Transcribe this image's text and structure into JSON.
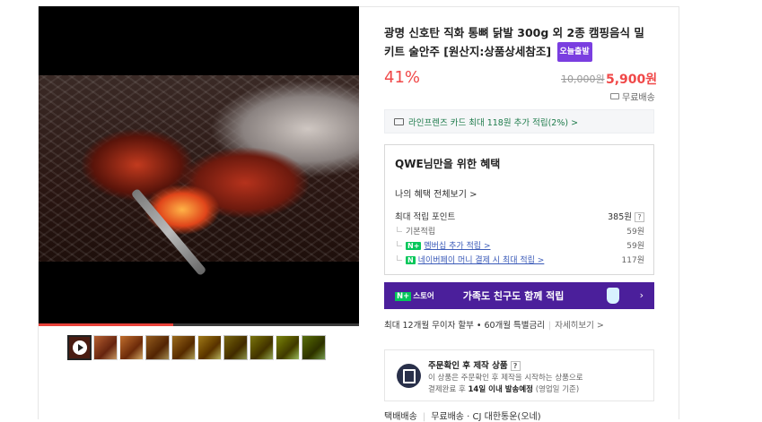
{
  "product": {
    "title": "광명 신호탄 직화 통뼈 닭발 300g 외 2종 캠핑음식 밀키트 술안주 [원산지:상품상세참조]",
    "badge": "오늘출발",
    "discount": "41%",
    "original_price": "10,000원",
    "price": "5,900원",
    "shipping_label": "무료배송"
  },
  "media": {
    "progress_fraction": 0.42,
    "thumbnail_count": 10
  },
  "card_promo": "라인프렌즈 카드 최대 118원 추가 적립(2%) >",
  "benefit": {
    "title": "QWE님만을 위한 혜택",
    "view_all": "나의 혜택 전체보기 >",
    "max_points_label": "최대 적립 포인트",
    "max_points_value": "385원",
    "help": "?",
    "rows": [
      {
        "label": "기본적립",
        "value": "59원"
      },
      {
        "label": "멤버십 추가 적립 >",
        "value": "59원",
        "icon": "N+"
      },
      {
        "label": "네이버페이 머니 결제 시 최대 적립 >",
        "value": "117원",
        "icon": "N"
      }
    ]
  },
  "banner": {
    "logo_mark": "N+",
    "logo_text": "스토어",
    "text": "가족도 친구도 함께 적립",
    "arrow": "›"
  },
  "installment": {
    "text": "최대 12개월 무이자 할부 • 60개월 특별금리",
    "more": "자세히보기 >"
  },
  "notice": {
    "title": "주문확인 후 제작 상품",
    "help": "?",
    "line1": "이 상품은 주문확인 후 제작을 시작하는 상품으로",
    "line2_prefix": "결제완료 후 ",
    "line2_bold": "14일 이내 발송예정",
    "line2_suffix": " (영업일 기준)"
  },
  "shipping": {
    "label": "택배배송",
    "value": "무료배송 · CJ 대한통운(오네)"
  }
}
